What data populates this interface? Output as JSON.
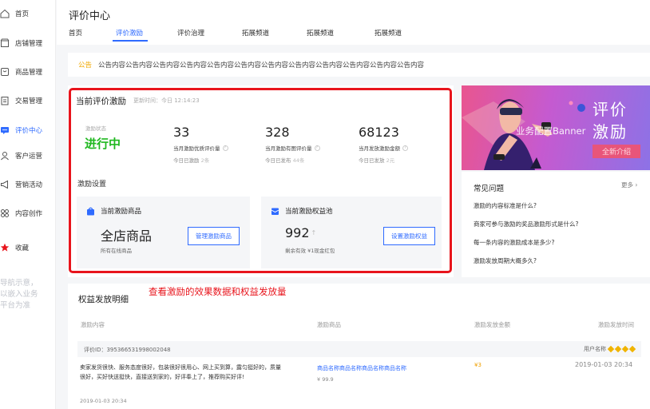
{
  "sidebar": {
    "items": [
      {
        "label": "首页",
        "icon": "home-icon"
      },
      {
        "label": "店铺管理",
        "icon": "store-icon"
      },
      {
        "label": "商品管理",
        "icon": "product-icon"
      },
      {
        "label": "交易管理",
        "icon": "trade-icon"
      },
      {
        "label": "评价中心",
        "icon": "chat-icon",
        "active": true
      },
      {
        "label": "客户运营",
        "icon": "user-icon"
      },
      {
        "label": "营销活动",
        "icon": "megaphone-icon"
      },
      {
        "label": "内容创作",
        "icon": "grid-icon"
      },
      {
        "label": "收藏",
        "icon": "star-icon"
      }
    ],
    "note": "导航示意，\n以嵌入业务\n平台为准"
  },
  "header": {
    "title": "评价中心",
    "tabs": [
      "首页",
      "评价激励",
      "评价治理",
      "拓展频道",
      "拓展频道",
      "拓展频道"
    ],
    "active_tab": 1
  },
  "notice": {
    "label": "公告",
    "text": "公告内容公告内容公告内容公告内容公告内容公告内容公告内容公告内容公告内容公告内容公告内容公告内容"
  },
  "incentive": {
    "title": "当前评价激励",
    "update_time": "更新时间：今日 12:14:23",
    "status_label": "激励状态",
    "status_value": "进行中",
    "stats": [
      {
        "value": "33",
        "label": "当月激励优质评价量",
        "sub_prefix": "今日已激励",
        "sub_value": "2条"
      },
      {
        "value": "328",
        "label": "当月激励有图评价量",
        "sub_prefix": "今日已发布",
        "sub_value": "44条"
      },
      {
        "value": "68123",
        "label": "当月发放激励金额",
        "sub_prefix": "今日已发放",
        "sub_value": "2元"
      }
    ],
    "settings_title": "激励设置",
    "product_card": {
      "title": "当前激励商品",
      "value": "全店商品",
      "note": "所有在线商品",
      "button": "管理激励商品"
    },
    "pool_card": {
      "title": "当前激励权益池",
      "value": "992",
      "note": "剩余有效 ¥1现金红包",
      "button": "设置激励权益"
    }
  },
  "banner": {
    "text": "业务配置Banner",
    "big_line1": "评价",
    "big_line2": "激励",
    "badge": "全新介绍"
  },
  "faq": {
    "title": "常见问题",
    "more": "更多 ›",
    "questions": [
      "激励的内容标准是什么?",
      "商家可参与激励的奖品激励形式是什么?",
      "每一条内容的激励成本是多少?",
      "激励发放周期大概多久?"
    ]
  },
  "annotation": "查看激励的效果数据和权益发放量",
  "detail": {
    "title": "权益发放明细",
    "columns": [
      "激励内容",
      "激励商品",
      "激励发放金额",
      "激励发放时间"
    ],
    "row": {
      "review_id": "评价ID：395366531998002048",
      "user": "用户名称",
      "review_text": "卖家发货很快、服务态度很好，包装很好很用心、网上买到算，露匀挺好的，质量很好，买好快送挺快，直接送到家的，好评奉上了，推荐购买好评!",
      "review_date": "2019-01-03 20:34",
      "product_name": "商品名称商品名称商品名称商品名称",
      "product_price": "¥ 99.9",
      "amount": "¥3",
      "release_time": "2019-01-03 20:34"
    }
  },
  "colors": {
    "accent": "#2f6bff",
    "status_green": "#20b820",
    "annotation_red": "#e8141c",
    "notice_orange": "#f0a800"
  }
}
